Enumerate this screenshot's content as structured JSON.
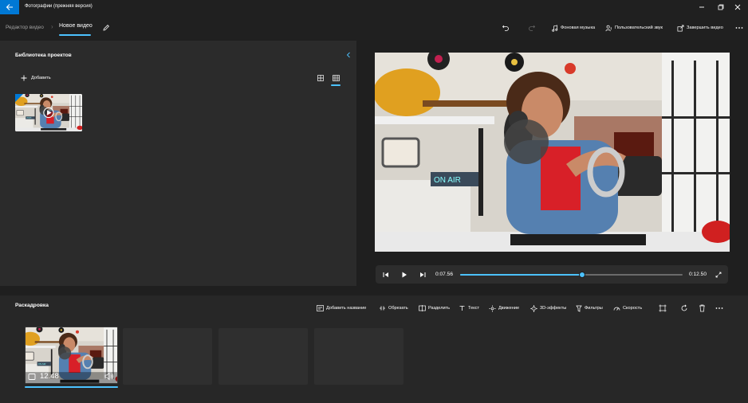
{
  "app": {
    "title": "Фотографии (прежняя версия)"
  },
  "breadcrumb": {
    "root": "Редактор видео",
    "current": "Новое видео"
  },
  "toolbar": {
    "background_music": "Фоновая музыка",
    "custom_audio": "Пользовательский звук",
    "finish_video": "Завершить видео"
  },
  "library": {
    "title": "Библиотека проектов",
    "add_label": "Добавить"
  },
  "player": {
    "current_time": "0:07.56",
    "total_time": "0:12.50",
    "progress": 0.55
  },
  "storyboard": {
    "title": "Раскадровка",
    "actions": {
      "add_title": "Добавить название",
      "trim": "Обрезать",
      "split": "Разделить",
      "text": "Текст",
      "motion": "Движение",
      "effects3d": "3D-эффекты",
      "filters": "Фильтры",
      "speed": "Скорость"
    },
    "clip_duration": "12.48"
  },
  "colors": {
    "accent": "#4cc2ff",
    "back_button": "#0078d4",
    "panel": "#2b2b2b",
    "background": "#1f1f1f"
  }
}
